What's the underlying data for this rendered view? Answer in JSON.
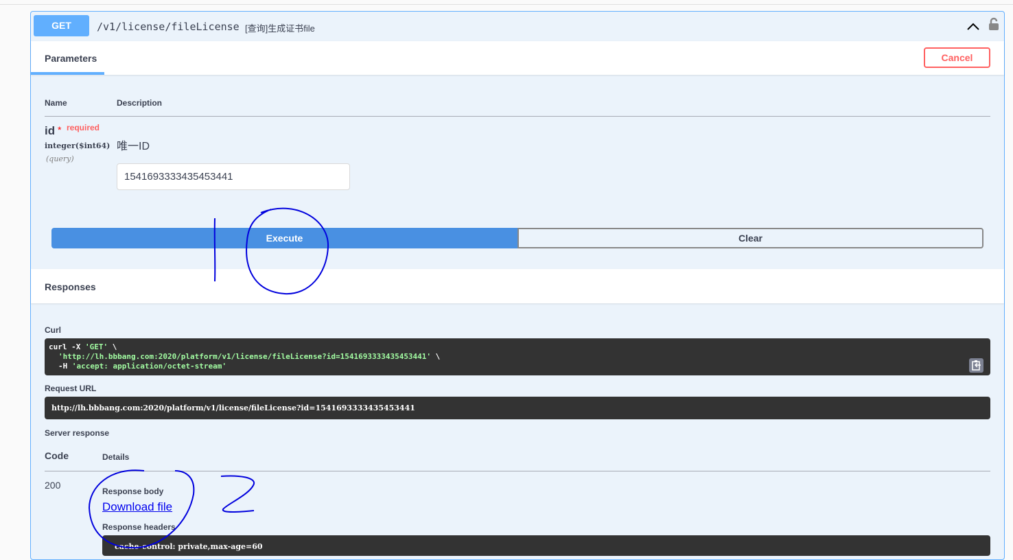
{
  "operation": {
    "method": "GET",
    "path": "/v1/license/fileLicense",
    "summary": "[查询]生成证书file"
  },
  "tabs": {
    "parameters": "Parameters",
    "cancel": "Cancel"
  },
  "params_table": {
    "name_header": "Name",
    "description_header": "Description"
  },
  "param": {
    "name": "id",
    "star": "*",
    "required": "required",
    "type": "integer($int64)",
    "in": "(query)",
    "description": "唯一ID",
    "value": "1541693333435453441"
  },
  "actions": {
    "execute": "Execute",
    "clear": "Clear"
  },
  "responses": {
    "title": "Responses",
    "curl_label": "Curl",
    "curl": {
      "l1a": "curl -X ",
      "l1b": "'GET'",
      "l1c": " \\",
      "l2": "'http://lh.bbbang.com:2020/platform/v1/license/fileLicense?id=1541693333435453441'",
      "l2c": " \\",
      "l3a": "-H ",
      "l3b": "'accept: application/octet-stream'"
    },
    "request_url_label": "Request URL",
    "request_url": "http://lh.bbbang.com:2020/platform/v1/license/fileLicense?id=1541693333435453441",
    "server_response_label": "Server response",
    "code_header": "Code",
    "details_header": "Details",
    "code": "200",
    "body_label": "Response body",
    "download": "Download file",
    "headers_label": "Response headers",
    "headers": "cache-control: private,max-age=60"
  },
  "colors": {
    "get": "#61affe",
    "execute": "#4990e2",
    "cancel": "#ff6060",
    "annotation": "#0000dd"
  }
}
